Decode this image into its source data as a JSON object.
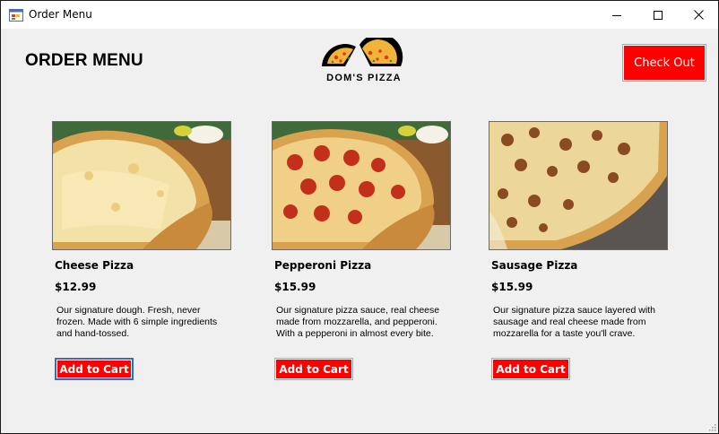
{
  "window": {
    "title": "Order Menu",
    "app_icon": "form-icon",
    "controls": [
      "minimize-icon",
      "maximize-icon",
      "close-icon"
    ]
  },
  "header": {
    "title": "ORDER MENU",
    "logo_text": "DOM'S PIZZA",
    "checkout_label": "Check Out"
  },
  "products": [
    {
      "name": "Cheese Pizza",
      "price": "$12.99",
      "description": "Our signature dough. Fresh, never frozen. Made with 6 simple ingredients and hand-tossed.",
      "button": "Add to Cart"
    },
    {
      "name": "Pepperoni Pizza",
      "price": "$15.99",
      "description": "Our signature pizza sauce, real cheese made from mozzarella, and pepperoni. With a pepperoni in almost every bite.",
      "button": "Add to Cart"
    },
    {
      "name": "Sausage Pizza",
      "price": "$15.99",
      "description": "Our signature pizza sauce layered with sausage and real cheese made from mozzarella for a taste you'll crave.",
      "button": "Add to Cart"
    }
  ],
  "colors": {
    "button_red": "#ff0000",
    "window_bg": "#f0f0f0",
    "focus_border": "#2b6fc7"
  }
}
